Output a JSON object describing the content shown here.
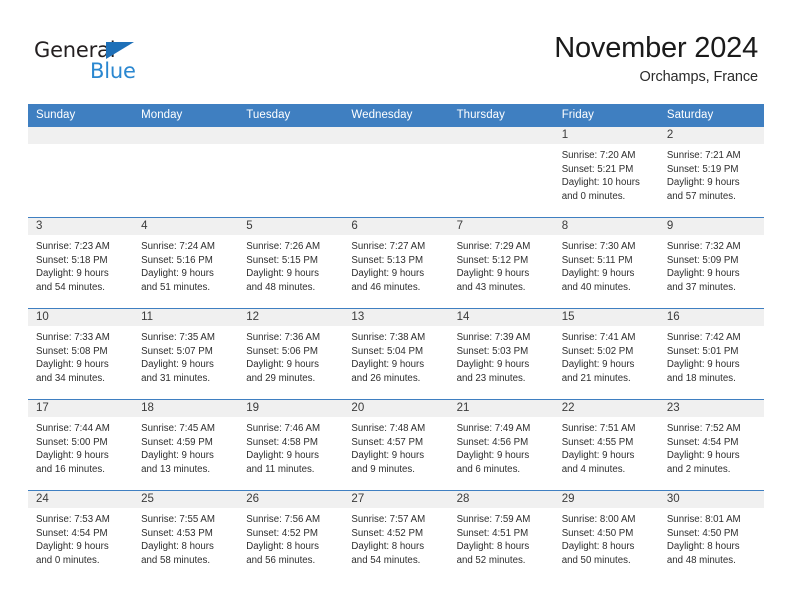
{
  "brand": {
    "word_one": "General",
    "word_two": "Blue",
    "accent_color": "#2a87d0",
    "triangle_color": "#1e70b8"
  },
  "header": {
    "title": "November 2024",
    "subtitle": "Orchamps, France"
  },
  "theme": {
    "header_bg": "#3f7fc1",
    "daynum_bg": "#f0f0f0",
    "text_color": "#2e2e2e"
  },
  "weekday_headers": [
    "Sunday",
    "Monday",
    "Tuesday",
    "Wednesday",
    "Thursday",
    "Friday",
    "Saturday"
  ],
  "weeks": [
    [
      {
        "day": "",
        "sunrise": "",
        "sunset": "",
        "daylight_1": "",
        "daylight_2": ""
      },
      {
        "day": "",
        "sunrise": "",
        "sunset": "",
        "daylight_1": "",
        "daylight_2": ""
      },
      {
        "day": "",
        "sunrise": "",
        "sunset": "",
        "daylight_1": "",
        "daylight_2": ""
      },
      {
        "day": "",
        "sunrise": "",
        "sunset": "",
        "daylight_1": "",
        "daylight_2": ""
      },
      {
        "day": "",
        "sunrise": "",
        "sunset": "",
        "daylight_1": "",
        "daylight_2": ""
      },
      {
        "day": "1",
        "sunrise": "Sunrise: 7:20 AM",
        "sunset": "Sunset: 5:21 PM",
        "daylight_1": "Daylight: 10 hours",
        "daylight_2": "and 0 minutes."
      },
      {
        "day": "2",
        "sunrise": "Sunrise: 7:21 AM",
        "sunset": "Sunset: 5:19 PM",
        "daylight_1": "Daylight: 9 hours",
        "daylight_2": "and 57 minutes."
      }
    ],
    [
      {
        "day": "3",
        "sunrise": "Sunrise: 7:23 AM",
        "sunset": "Sunset: 5:18 PM",
        "daylight_1": "Daylight: 9 hours",
        "daylight_2": "and 54 minutes."
      },
      {
        "day": "4",
        "sunrise": "Sunrise: 7:24 AM",
        "sunset": "Sunset: 5:16 PM",
        "daylight_1": "Daylight: 9 hours",
        "daylight_2": "and 51 minutes."
      },
      {
        "day": "5",
        "sunrise": "Sunrise: 7:26 AM",
        "sunset": "Sunset: 5:15 PM",
        "daylight_1": "Daylight: 9 hours",
        "daylight_2": "and 48 minutes."
      },
      {
        "day": "6",
        "sunrise": "Sunrise: 7:27 AM",
        "sunset": "Sunset: 5:13 PM",
        "daylight_1": "Daylight: 9 hours",
        "daylight_2": "and 46 minutes."
      },
      {
        "day": "7",
        "sunrise": "Sunrise: 7:29 AM",
        "sunset": "Sunset: 5:12 PM",
        "daylight_1": "Daylight: 9 hours",
        "daylight_2": "and 43 minutes."
      },
      {
        "day": "8",
        "sunrise": "Sunrise: 7:30 AM",
        "sunset": "Sunset: 5:11 PM",
        "daylight_1": "Daylight: 9 hours",
        "daylight_2": "and 40 minutes."
      },
      {
        "day": "9",
        "sunrise": "Sunrise: 7:32 AM",
        "sunset": "Sunset: 5:09 PM",
        "daylight_1": "Daylight: 9 hours",
        "daylight_2": "and 37 minutes."
      }
    ],
    [
      {
        "day": "10",
        "sunrise": "Sunrise: 7:33 AM",
        "sunset": "Sunset: 5:08 PM",
        "daylight_1": "Daylight: 9 hours",
        "daylight_2": "and 34 minutes."
      },
      {
        "day": "11",
        "sunrise": "Sunrise: 7:35 AM",
        "sunset": "Sunset: 5:07 PM",
        "daylight_1": "Daylight: 9 hours",
        "daylight_2": "and 31 minutes."
      },
      {
        "day": "12",
        "sunrise": "Sunrise: 7:36 AM",
        "sunset": "Sunset: 5:06 PM",
        "daylight_1": "Daylight: 9 hours",
        "daylight_2": "and 29 minutes."
      },
      {
        "day": "13",
        "sunrise": "Sunrise: 7:38 AM",
        "sunset": "Sunset: 5:04 PM",
        "daylight_1": "Daylight: 9 hours",
        "daylight_2": "and 26 minutes."
      },
      {
        "day": "14",
        "sunrise": "Sunrise: 7:39 AM",
        "sunset": "Sunset: 5:03 PM",
        "daylight_1": "Daylight: 9 hours",
        "daylight_2": "and 23 minutes."
      },
      {
        "day": "15",
        "sunrise": "Sunrise: 7:41 AM",
        "sunset": "Sunset: 5:02 PM",
        "daylight_1": "Daylight: 9 hours",
        "daylight_2": "and 21 minutes."
      },
      {
        "day": "16",
        "sunrise": "Sunrise: 7:42 AM",
        "sunset": "Sunset: 5:01 PM",
        "daylight_1": "Daylight: 9 hours",
        "daylight_2": "and 18 minutes."
      }
    ],
    [
      {
        "day": "17",
        "sunrise": "Sunrise: 7:44 AM",
        "sunset": "Sunset: 5:00 PM",
        "daylight_1": "Daylight: 9 hours",
        "daylight_2": "and 16 minutes."
      },
      {
        "day": "18",
        "sunrise": "Sunrise: 7:45 AM",
        "sunset": "Sunset: 4:59 PM",
        "daylight_1": "Daylight: 9 hours",
        "daylight_2": "and 13 minutes."
      },
      {
        "day": "19",
        "sunrise": "Sunrise: 7:46 AM",
        "sunset": "Sunset: 4:58 PM",
        "daylight_1": "Daylight: 9 hours",
        "daylight_2": "and 11 minutes."
      },
      {
        "day": "20",
        "sunrise": "Sunrise: 7:48 AM",
        "sunset": "Sunset: 4:57 PM",
        "daylight_1": "Daylight: 9 hours",
        "daylight_2": "and 9 minutes."
      },
      {
        "day": "21",
        "sunrise": "Sunrise: 7:49 AM",
        "sunset": "Sunset: 4:56 PM",
        "daylight_1": "Daylight: 9 hours",
        "daylight_2": "and 6 minutes."
      },
      {
        "day": "22",
        "sunrise": "Sunrise: 7:51 AM",
        "sunset": "Sunset: 4:55 PM",
        "daylight_1": "Daylight: 9 hours",
        "daylight_2": "and 4 minutes."
      },
      {
        "day": "23",
        "sunrise": "Sunrise: 7:52 AM",
        "sunset": "Sunset: 4:54 PM",
        "daylight_1": "Daylight: 9 hours",
        "daylight_2": "and 2 minutes."
      }
    ],
    [
      {
        "day": "24",
        "sunrise": "Sunrise: 7:53 AM",
        "sunset": "Sunset: 4:54 PM",
        "daylight_1": "Daylight: 9 hours",
        "daylight_2": "and 0 minutes."
      },
      {
        "day": "25",
        "sunrise": "Sunrise: 7:55 AM",
        "sunset": "Sunset: 4:53 PM",
        "daylight_1": "Daylight: 8 hours",
        "daylight_2": "and 58 minutes."
      },
      {
        "day": "26",
        "sunrise": "Sunrise: 7:56 AM",
        "sunset": "Sunset: 4:52 PM",
        "daylight_1": "Daylight: 8 hours",
        "daylight_2": "and 56 minutes."
      },
      {
        "day": "27",
        "sunrise": "Sunrise: 7:57 AM",
        "sunset": "Sunset: 4:52 PM",
        "daylight_1": "Daylight: 8 hours",
        "daylight_2": "and 54 minutes."
      },
      {
        "day": "28",
        "sunrise": "Sunrise: 7:59 AM",
        "sunset": "Sunset: 4:51 PM",
        "daylight_1": "Daylight: 8 hours",
        "daylight_2": "and 52 minutes."
      },
      {
        "day": "29",
        "sunrise": "Sunrise: 8:00 AM",
        "sunset": "Sunset: 4:50 PM",
        "daylight_1": "Daylight: 8 hours",
        "daylight_2": "and 50 minutes."
      },
      {
        "day": "30",
        "sunrise": "Sunrise: 8:01 AM",
        "sunset": "Sunset: 4:50 PM",
        "daylight_1": "Daylight: 8 hours",
        "daylight_2": "and 48 minutes."
      }
    ]
  ]
}
